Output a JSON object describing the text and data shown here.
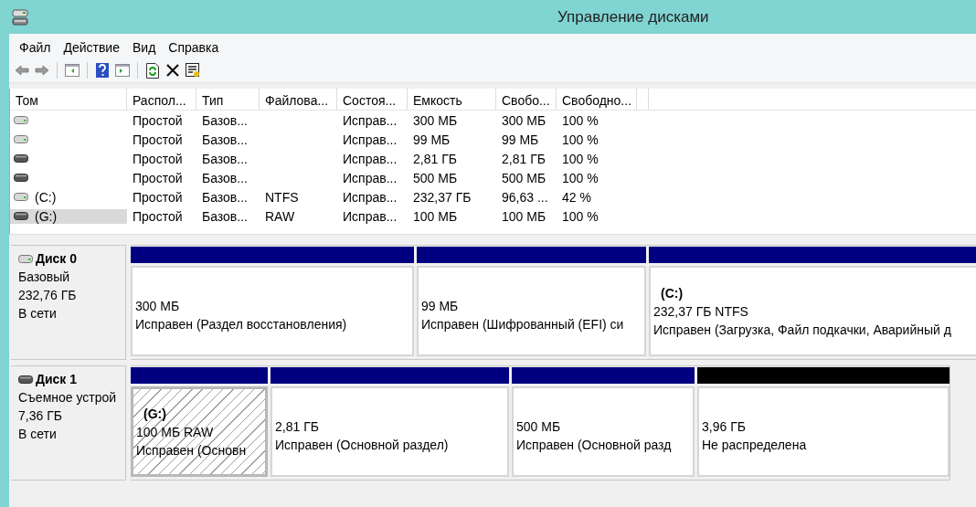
{
  "window": {
    "title": "Управление дисками"
  },
  "menu": [
    "Файл",
    "Действие",
    "Вид",
    "Справка"
  ],
  "volume_table": {
    "columns": [
      "Том",
      "Распол...",
      "Тип",
      "Файлова...",
      "Состоя...",
      "Емкость",
      "Свобо...",
      "Свободно..."
    ],
    "rows": [
      {
        "kind": "fixed",
        "selected": false,
        "layout": "Простой",
        "type": "Базов...",
        "status": "Исправ...",
        "capacity": "300 МБ",
        "free": "300 МБ",
        "free_pct": "100 %"
      },
      {
        "kind": "fixed",
        "selected": false,
        "layout": "Простой",
        "type": "Базов...",
        "status": "Исправ...",
        "capacity": "99 МБ",
        "free": "99 МБ",
        "free_pct": "100 %"
      },
      {
        "kind": "removable",
        "selected": false,
        "layout": "Простой",
        "type": "Базов...",
        "status": "Исправ...",
        "capacity": "2,81 ГБ",
        "free": "2,81 ГБ",
        "free_pct": "100 %"
      },
      {
        "kind": "removable",
        "selected": false,
        "layout": "Простой",
        "type": "Базов...",
        "status": "Исправ...",
        "capacity": "500 МБ",
        "free": "500 МБ",
        "free_pct": "100 %"
      },
      {
        "kind": "fixed",
        "selected": false,
        "volume": "(C:)",
        "layout": "Простой",
        "type": "Базов...",
        "filesystem": "NTFS",
        "status": "Исправ...",
        "capacity": "232,37 ГБ",
        "free": "96,63 ...",
        "free_pct": "42 %"
      },
      {
        "kind": "removable",
        "selected": true,
        "volume": "(G:)",
        "layout": "Простой",
        "type": "Базов...",
        "filesystem": "RAW",
        "status": "Исправ...",
        "capacity": "100 МБ",
        "free": "100 МБ",
        "free_pct": "100 %"
      }
    ]
  },
  "disks": [
    {
      "kind": "fixed",
      "name": "Диск 0",
      "type": "Базовый",
      "size": "232,76 ГБ",
      "status": "В сети",
      "partitions": [
        {
          "kind": "primary",
          "selected": false,
          "size": "300 МБ",
          "status": "Исправен (Раздел восстановления)"
        },
        {
          "kind": "primary",
          "selected": false,
          "size": "99 МБ",
          "status": "Исправен (Шифрованный (EFI) си"
        },
        {
          "kind": "primary",
          "selected": false,
          "label": "(C:)",
          "size": "232,37 ГБ NTFS",
          "status": "Исправен (Загрузка, Файл подкачки, Аварийный д"
        }
      ]
    },
    {
      "kind": "removable",
      "name": "Диск 1",
      "type": "Съемное устрой",
      "size": "7,36 ГБ",
      "status": "В сети",
      "partitions": [
        {
          "kind": "primary",
          "selected": true,
          "label": "(G:)",
          "size": "100 МБ RAW",
          "status": "Исправен (Основн"
        },
        {
          "kind": "primary",
          "selected": false,
          "size": "2,81 ГБ",
          "status": "Исправен (Основной раздел)"
        },
        {
          "kind": "primary",
          "selected": false,
          "size": "500 МБ",
          "status": "Исправен (Основной разд"
        },
        {
          "kind": "unallocated",
          "selected": false,
          "size": "3,96 ГБ",
          "status": "Не распределена"
        }
      ]
    }
  ]
}
